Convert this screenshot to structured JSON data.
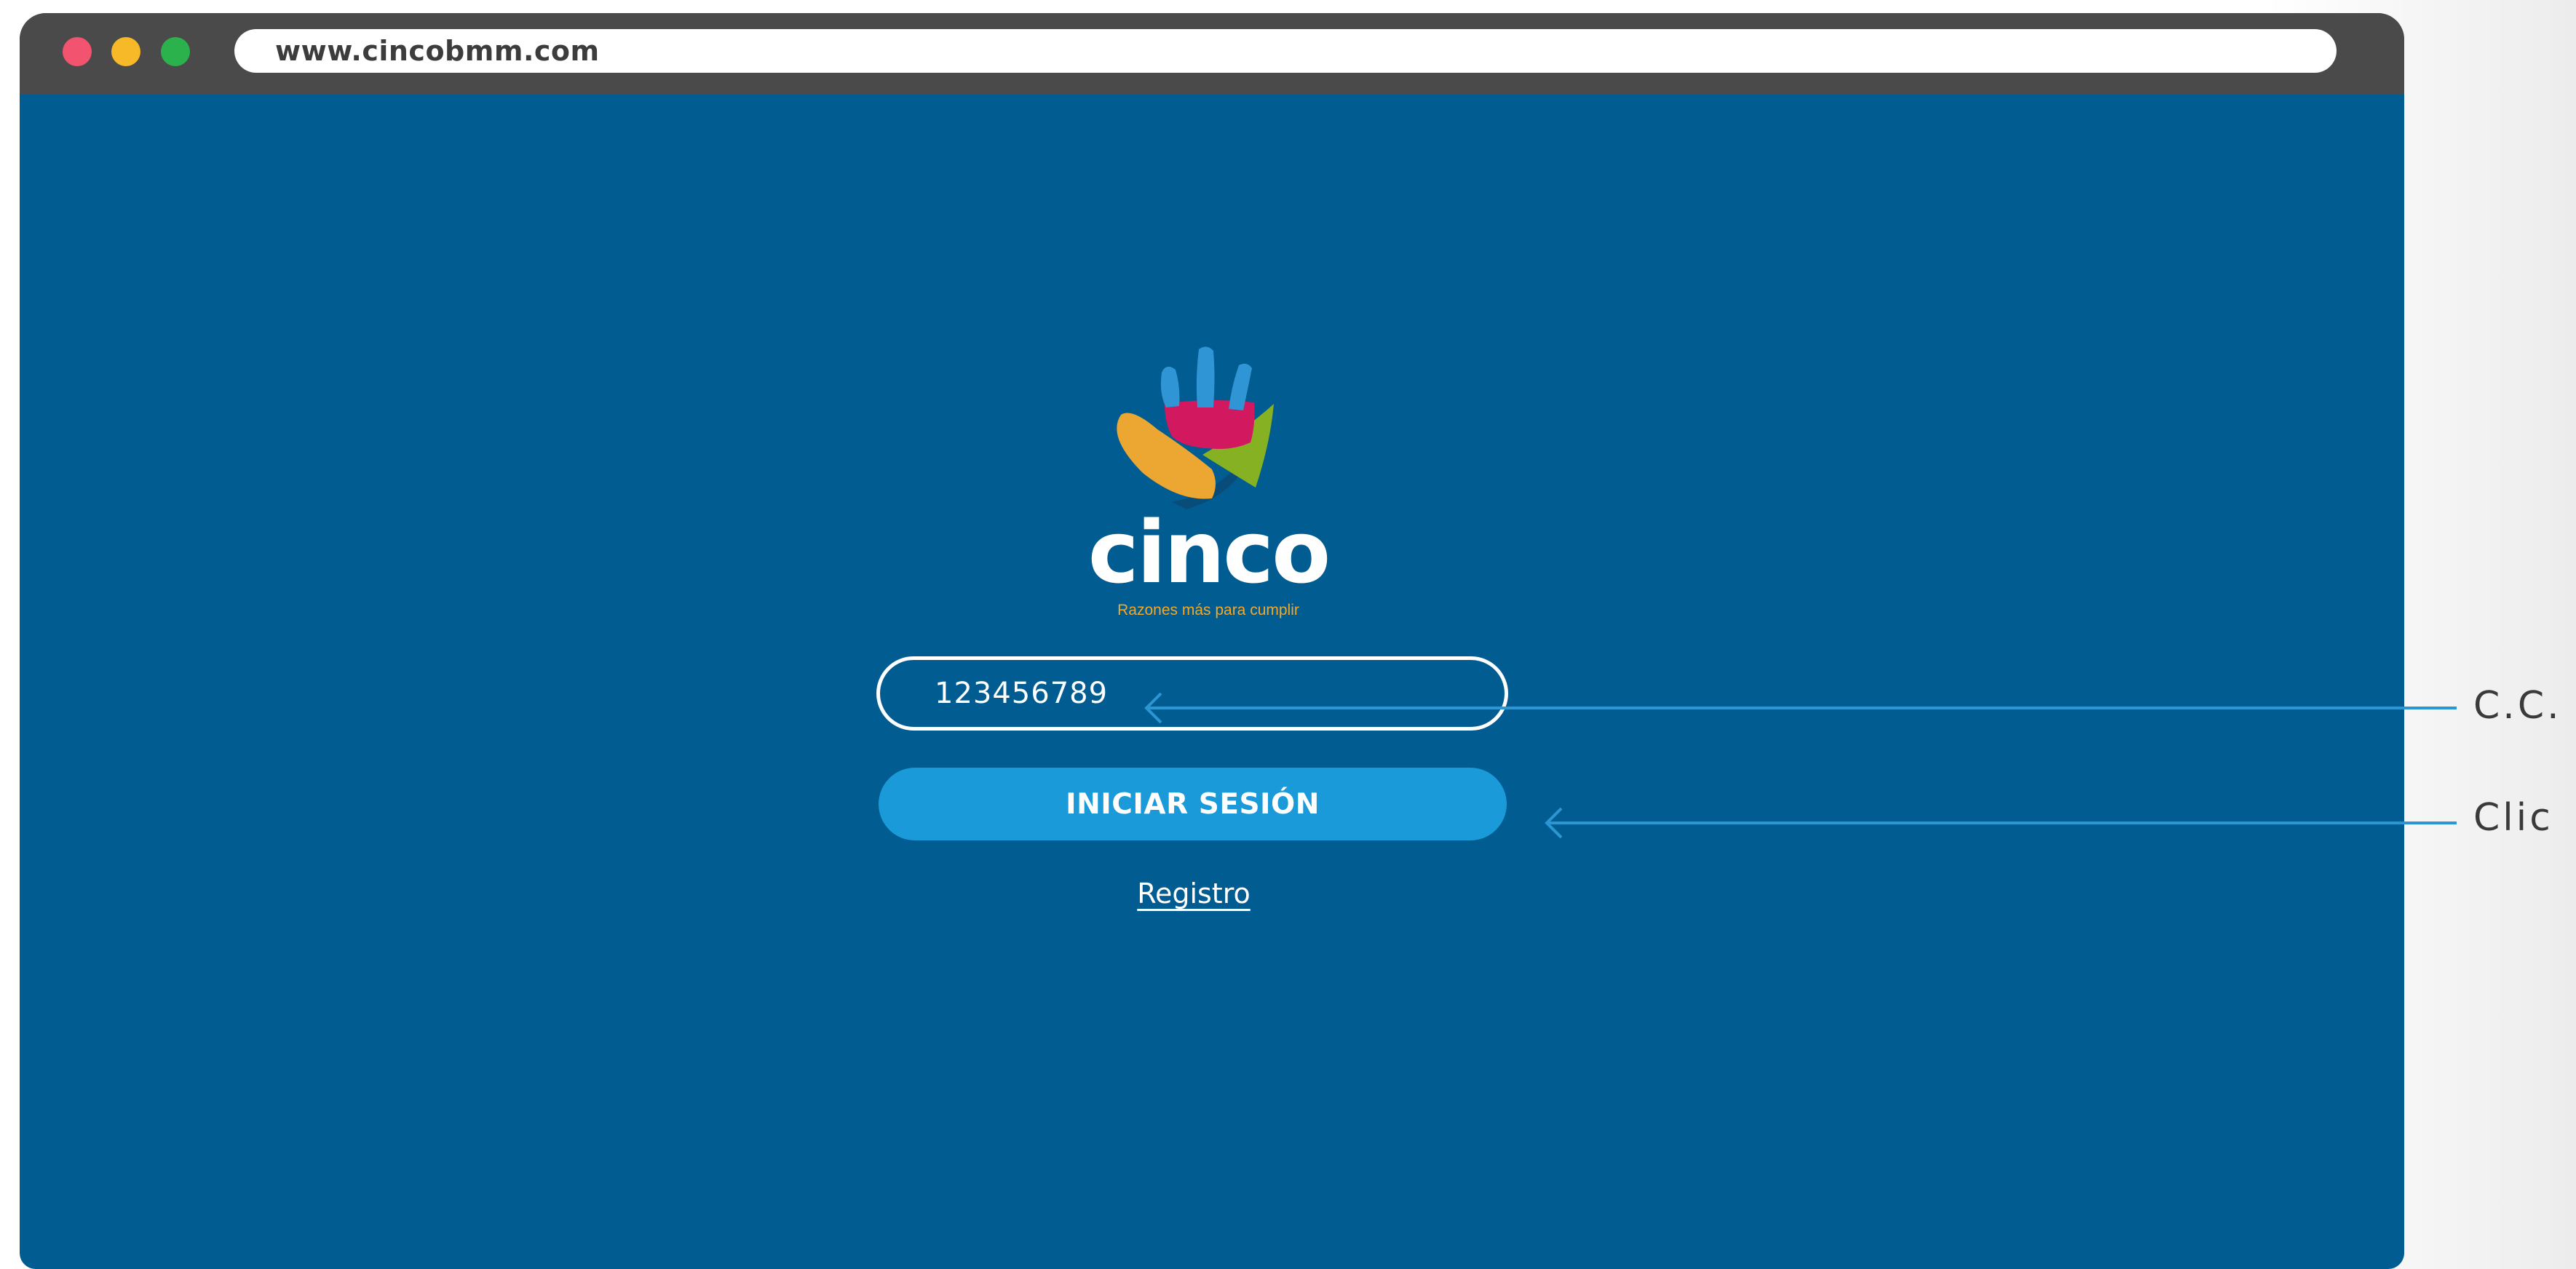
{
  "browser": {
    "url": "www.cincobmm.com",
    "controls": [
      {
        "name": "close",
        "color": "#f2546f"
      },
      {
        "name": "minimize",
        "color": "#f7b928"
      },
      {
        "name": "maximize",
        "color": "#2bb24c"
      }
    ]
  },
  "page": {
    "background_color": "#015c91",
    "logo": {
      "brand": "cinco",
      "tagline": "Razones más para cumplir",
      "colors": {
        "blue": "#2f95d4",
        "magenta": "#d2185e",
        "green": "#86b122",
        "orange": "#eba732",
        "shadow": "#084d7a"
      }
    },
    "id_field": {
      "value": "123456789",
      "placeholder": ""
    },
    "login_button": {
      "label": "INICIAR SESIÓN",
      "color": "#1a9ad8"
    },
    "register_link": {
      "label": "Registro"
    }
  },
  "annotations": {
    "arrow_color": "#2c96d3",
    "items": [
      {
        "label": "C.C.",
        "points_to": "id_field"
      },
      {
        "label": "Clic",
        "points_to": "login_button"
      }
    ]
  }
}
